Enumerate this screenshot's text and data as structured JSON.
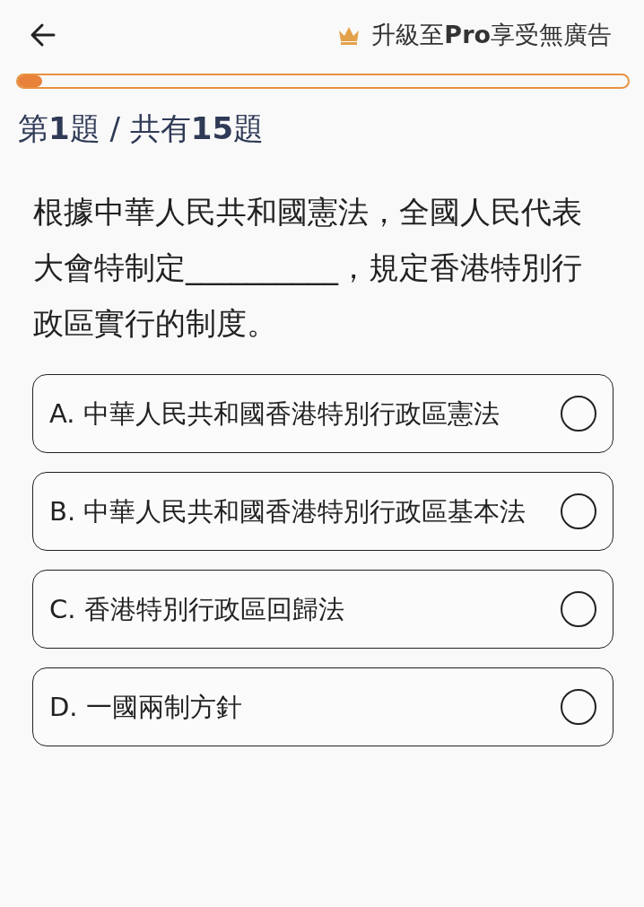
{
  "header": {
    "upgrade": "升級至**Pro**享受無廣告"
  },
  "progress": {
    "level": 0.04
  },
  "counter": "第**1**題 / 共有**15**題",
  "question": "根據中華人民共和國憲法，全國人民代表大會特制定__________，規定香港特別行政區實行的制度。",
  "options": [
    {
      "label": "A. 中華人民共和國香港特別行政區憲法",
      "selected": false
    },
    {
      "label": "B. 中華人民共和國香港特別行政區基本法",
      "selected": false
    },
    {
      "label": "C. 香港特別行政區回歸法",
      "selected": false
    },
    {
      "label": "D. 一國兩制方針",
      "selected": false
    }
  ]
}
